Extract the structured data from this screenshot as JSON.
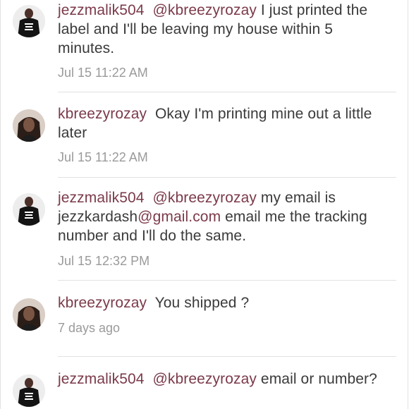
{
  "comments": [
    {
      "username": "jezzmalik504",
      "mention": "@kbreezyrozay",
      "text": " I just printed the label and I'll be leaving my house within 5 minutes.",
      "timestamp": "Jul 15 11:22 AM",
      "avatar_icon": "avatar-black-tshirt"
    },
    {
      "username": "kbreezyrozay",
      "text": "Okay I'm printing mine out a little later",
      "timestamp": "Jul 15 11:22 AM",
      "avatar_icon": "avatar-portrait"
    },
    {
      "username": "jezzmalik504",
      "mention": "@kbreezyrozay",
      "text_before_link": " my email is jezzkardash",
      "link": "@gmail.com",
      "text_after_link": " email me the tracking number and I'll do the same.",
      "timestamp": "Jul 15 12:32 PM",
      "avatar_icon": "avatar-black-tshirt"
    },
    {
      "username": "kbreezyrozay",
      "text": "You shipped ?",
      "timestamp": "7 days ago",
      "avatar_icon": "avatar-portrait"
    },
    {
      "username": "jezzmalik504",
      "mention": "@kbreezyrozay",
      "text": " email or number?",
      "avatar_icon": "avatar-black-tshirt"
    }
  ],
  "colors": {
    "username": "#7b3a4a",
    "body_text": "#3a3a3a",
    "timestamp": "#9a9a9a",
    "divider": "#e1e1e1"
  }
}
